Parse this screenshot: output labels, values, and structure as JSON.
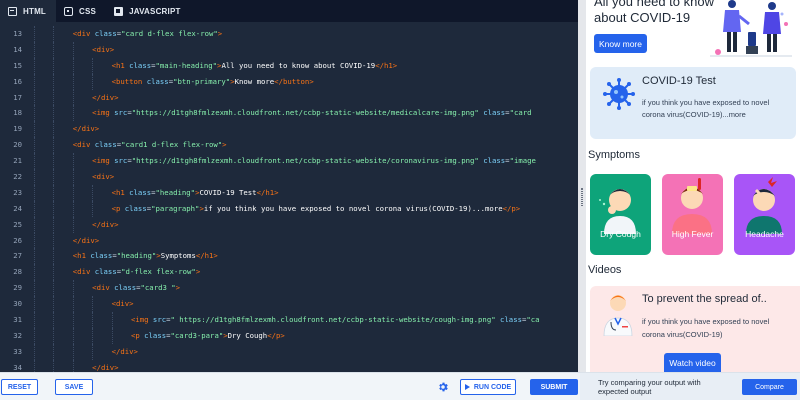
{
  "editor": {
    "tabs": [
      {
        "label": "HTML",
        "icon": "html-file-icon"
      },
      {
        "label": "CSS",
        "icon": "css-file-icon"
      },
      {
        "label": "JAVASCRIPT",
        "icon": "javascript-file-icon"
      }
    ],
    "lines": [
      {
        "n": "13",
        "indent": 2,
        "tokens": [
          [
            "tag",
            "<div "
          ],
          [
            "attr",
            "class"
          ],
          [
            "pun",
            "="
          ],
          [
            "str",
            "\"card d-flex flex-row\""
          ],
          [
            "tag",
            ">"
          ]
        ]
      },
      {
        "n": "14",
        "indent": 3,
        "tokens": [
          [
            "tag",
            "<div>"
          ]
        ]
      },
      {
        "n": "15",
        "indent": 4,
        "tokens": [
          [
            "tag",
            "<h1 "
          ],
          [
            "attr",
            "class"
          ],
          [
            "pun",
            "="
          ],
          [
            "str",
            "\"main-heading\""
          ],
          [
            "tag",
            ">"
          ],
          [
            "txt",
            "All you need to know about COVID-19"
          ],
          [
            "tag",
            "</h1>"
          ]
        ]
      },
      {
        "n": "16",
        "indent": 4,
        "tokens": [
          [
            "tag",
            "<button "
          ],
          [
            "attr",
            "class"
          ],
          [
            "pun",
            "="
          ],
          [
            "str",
            "\"btn-primary\""
          ],
          [
            "tag",
            ">"
          ],
          [
            "txt",
            "Know more"
          ],
          [
            "tag",
            "</button>"
          ]
        ]
      },
      {
        "n": "17",
        "indent": 3,
        "tokens": [
          [
            "tag",
            "</div>"
          ]
        ]
      },
      {
        "n": "18",
        "indent": 3,
        "tokens": [
          [
            "tag",
            "<img "
          ],
          [
            "attr",
            "src"
          ],
          [
            "pun",
            "="
          ],
          [
            "str",
            "\"https://d1tgh8fmlzexmh.cloudfront.net/ccbp-static-website/medicalcare-img.png\""
          ],
          [
            "txt",
            " "
          ],
          [
            "attr",
            "class"
          ],
          [
            "pun",
            "="
          ],
          [
            "str",
            "\"card"
          ]
        ]
      },
      {
        "n": "19",
        "indent": 2,
        "tokens": [
          [
            "tag",
            "</div>"
          ]
        ]
      },
      {
        "n": "20",
        "indent": 2,
        "tokens": [
          [
            "tag",
            "<div "
          ],
          [
            "attr",
            "class"
          ],
          [
            "pun",
            "="
          ],
          [
            "str",
            "\"card1 d-flex flex-row\""
          ],
          [
            "tag",
            ">"
          ]
        ]
      },
      {
        "n": "21",
        "indent": 3,
        "tokens": [
          [
            "tag",
            "<img "
          ],
          [
            "attr",
            "src"
          ],
          [
            "pun",
            "="
          ],
          [
            "str",
            "\"https://d1tgh8fmlzexmh.cloudfront.net/ccbp-static-website/coronavirus-img.png\""
          ],
          [
            "txt",
            " "
          ],
          [
            "attr",
            "class"
          ],
          [
            "pun",
            "="
          ],
          [
            "str",
            "\"image"
          ]
        ]
      },
      {
        "n": "22",
        "indent": 3,
        "tokens": [
          [
            "tag",
            "<div>"
          ]
        ]
      },
      {
        "n": "23",
        "indent": 4,
        "tokens": [
          [
            "tag",
            "<h1 "
          ],
          [
            "attr",
            "class"
          ],
          [
            "pun",
            "="
          ],
          [
            "str",
            "\"heading\""
          ],
          [
            "tag",
            ">"
          ],
          [
            "txt",
            "COVID-19 Test"
          ],
          [
            "tag",
            "</h1>"
          ]
        ]
      },
      {
        "n": "24",
        "indent": 4,
        "tokens": [
          [
            "tag",
            "<p "
          ],
          [
            "attr",
            "class"
          ],
          [
            "pun",
            "="
          ],
          [
            "str",
            "\"paragraph\""
          ],
          [
            "tag",
            ">"
          ],
          [
            "txt",
            "if you think you have exposed to novel corona virus(COVID-19)...more"
          ],
          [
            "tag",
            "</p>"
          ]
        ]
      },
      {
        "n": "25",
        "indent": 3,
        "tokens": [
          [
            "tag",
            "</div>"
          ]
        ]
      },
      {
        "n": "26",
        "indent": 2,
        "tokens": [
          [
            "tag",
            "</div>"
          ]
        ]
      },
      {
        "n": "27",
        "indent": 2,
        "tokens": [
          [
            "tag",
            "<h1 "
          ],
          [
            "attr",
            "class"
          ],
          [
            "pun",
            "="
          ],
          [
            "str",
            "\"heading\""
          ],
          [
            "tag",
            ">"
          ],
          [
            "txt",
            "Symptoms"
          ],
          [
            "tag",
            "</h1>"
          ]
        ]
      },
      {
        "n": "28",
        "indent": 2,
        "tokens": [
          [
            "tag",
            "<div "
          ],
          [
            "attr",
            "class"
          ],
          [
            "pun",
            "="
          ],
          [
            "str",
            "\"d-flex flex-row\""
          ],
          [
            "tag",
            ">"
          ]
        ]
      },
      {
        "n": "29",
        "indent": 3,
        "tokens": [
          [
            "tag",
            "<div "
          ],
          [
            "attr",
            "class"
          ],
          [
            "pun",
            "="
          ],
          [
            "str",
            "\"card3 \""
          ],
          [
            "tag",
            ">"
          ]
        ]
      },
      {
        "n": "30",
        "indent": 4,
        "tokens": [
          [
            "tag",
            "<div>"
          ]
        ]
      },
      {
        "n": "31",
        "indent": 5,
        "tokens": [
          [
            "tag",
            "<img "
          ],
          [
            "attr",
            "src"
          ],
          [
            "pun",
            "="
          ],
          [
            "str",
            "\" https://d1tgh8fmlzexmh.cloudfront.net/ccbp-static-website/cough-img.png\""
          ],
          [
            "txt",
            " "
          ],
          [
            "attr",
            "class"
          ],
          [
            "pun",
            "="
          ],
          [
            "str",
            "\"ca"
          ]
        ]
      },
      {
        "n": "32",
        "indent": 5,
        "tokens": [
          [
            "tag",
            "<p "
          ],
          [
            "attr",
            "class"
          ],
          [
            "pun",
            "="
          ],
          [
            "str",
            "\"card3-para\""
          ],
          [
            "tag",
            ">"
          ],
          [
            "txt",
            "Dry Cough"
          ],
          [
            "tag",
            "</p>"
          ]
        ]
      },
      {
        "n": "33",
        "indent": 4,
        "tokens": [
          [
            "tag",
            "</div>"
          ]
        ]
      },
      {
        "n": "34",
        "indent": 3,
        "tokens": [
          [
            "tag",
            "</div>"
          ]
        ]
      }
    ]
  },
  "toolbar": {
    "reset_label": "RESET",
    "save_label": "SAVE",
    "run_label": "RUN CODE",
    "submit_label": "SUBMIT"
  },
  "preview": {
    "hero": {
      "title": "All you need to know about COVID-19",
      "button": "Know more"
    },
    "test_card": {
      "heading": "COVID-19 Test",
      "paragraph": "if you think you have exposed to novel corona virus(COVID-19)...more"
    },
    "symptoms_heading": "Symptoms",
    "symptoms": [
      {
        "label": "Dry Cough",
        "color": "#0ea47a"
      },
      {
        "label": "High Fever",
        "color": "#f472b6"
      },
      {
        "label": "Headache",
        "color": "#a855f7"
      }
    ],
    "videos_heading": "Videos",
    "video_card": {
      "heading": "To prevent the spread of..",
      "paragraph": "if you think you have exposed to novel corona virus(COVID-19)",
      "button": "Watch video"
    }
  },
  "compare": {
    "text": "Try comparing your output with expected output",
    "button": "Compare"
  },
  "colors": {
    "editor_bg": "#1e293b",
    "accent": "#2563eb",
    "tag": "#f97316",
    "attr": "#7dd3fc",
    "string": "#86efac"
  }
}
